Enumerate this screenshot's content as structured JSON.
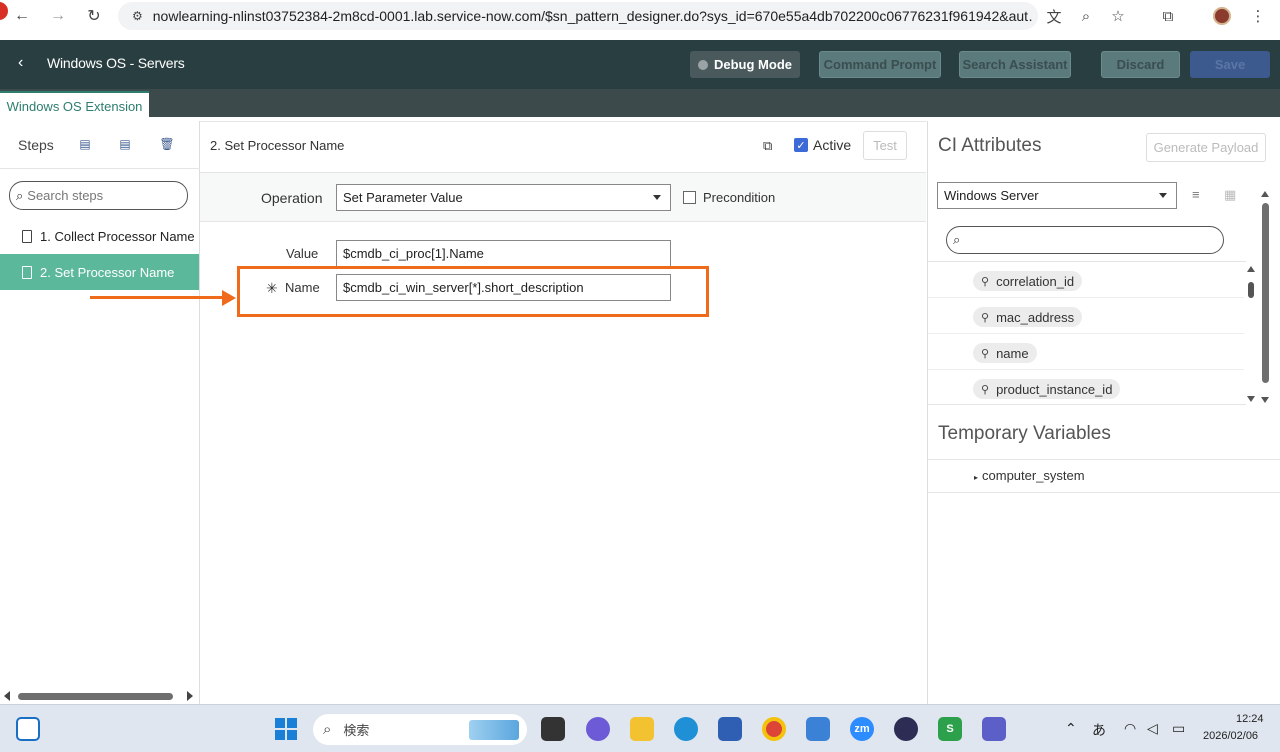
{
  "browser": {
    "url": "nowlearning-nlinst03752384-2m8cd-0001.lab.service-now.com/$sn_pattern_designer.do?sys_id=670e55a4db702200c06776231f961942&aut…"
  },
  "header": {
    "title": "Windows OS - Servers",
    "debug_mode": "Debug Mode",
    "command_prompt": "Command Prompt",
    "search_assistant": "Search Assistant",
    "discard": "Discard",
    "save": "Save"
  },
  "tab": {
    "label": "Windows OS Extension"
  },
  "steps": {
    "label": "Steps",
    "search_placeholder": "Search steps",
    "items": [
      {
        "label": "1. Collect Processor Name"
      },
      {
        "label": "2. Set Processor Name"
      }
    ]
  },
  "step_editor": {
    "title": "2. Set Processor Name",
    "active_label": "Active",
    "test_label": "Test",
    "operation_label": "Operation",
    "operation_value": "Set Parameter Value",
    "precondition_label": "Precondition",
    "value_label": "Value",
    "value_value": "$cmdb_ci_proc[1].Name",
    "name_required": "✳",
    "name_label": "Name",
    "name_value": "$cmdb_ci_win_server[*].short_description"
  },
  "ci_attributes": {
    "title": "CI Attributes",
    "generate_payload": "Generate Payload",
    "selected_class": "Windows Server",
    "attributes": [
      {
        "label": "correlation_id"
      },
      {
        "label": "mac_address"
      },
      {
        "label": "name"
      },
      {
        "label": "product_instance_id"
      }
    ]
  },
  "temporary_variables": {
    "title": "Temporary Variables",
    "items": [
      {
        "label": "computer_system"
      }
    ]
  },
  "taskbar": {
    "search_label": "検索",
    "ime": "あ",
    "time": "12:24",
    "date": "2026/02/06"
  },
  "colors": {
    "header_bg": "#293e40",
    "accent_green": "#5cb89a",
    "highlight_orange": "#f06a1c",
    "active_blue": "#3c6ad6"
  }
}
